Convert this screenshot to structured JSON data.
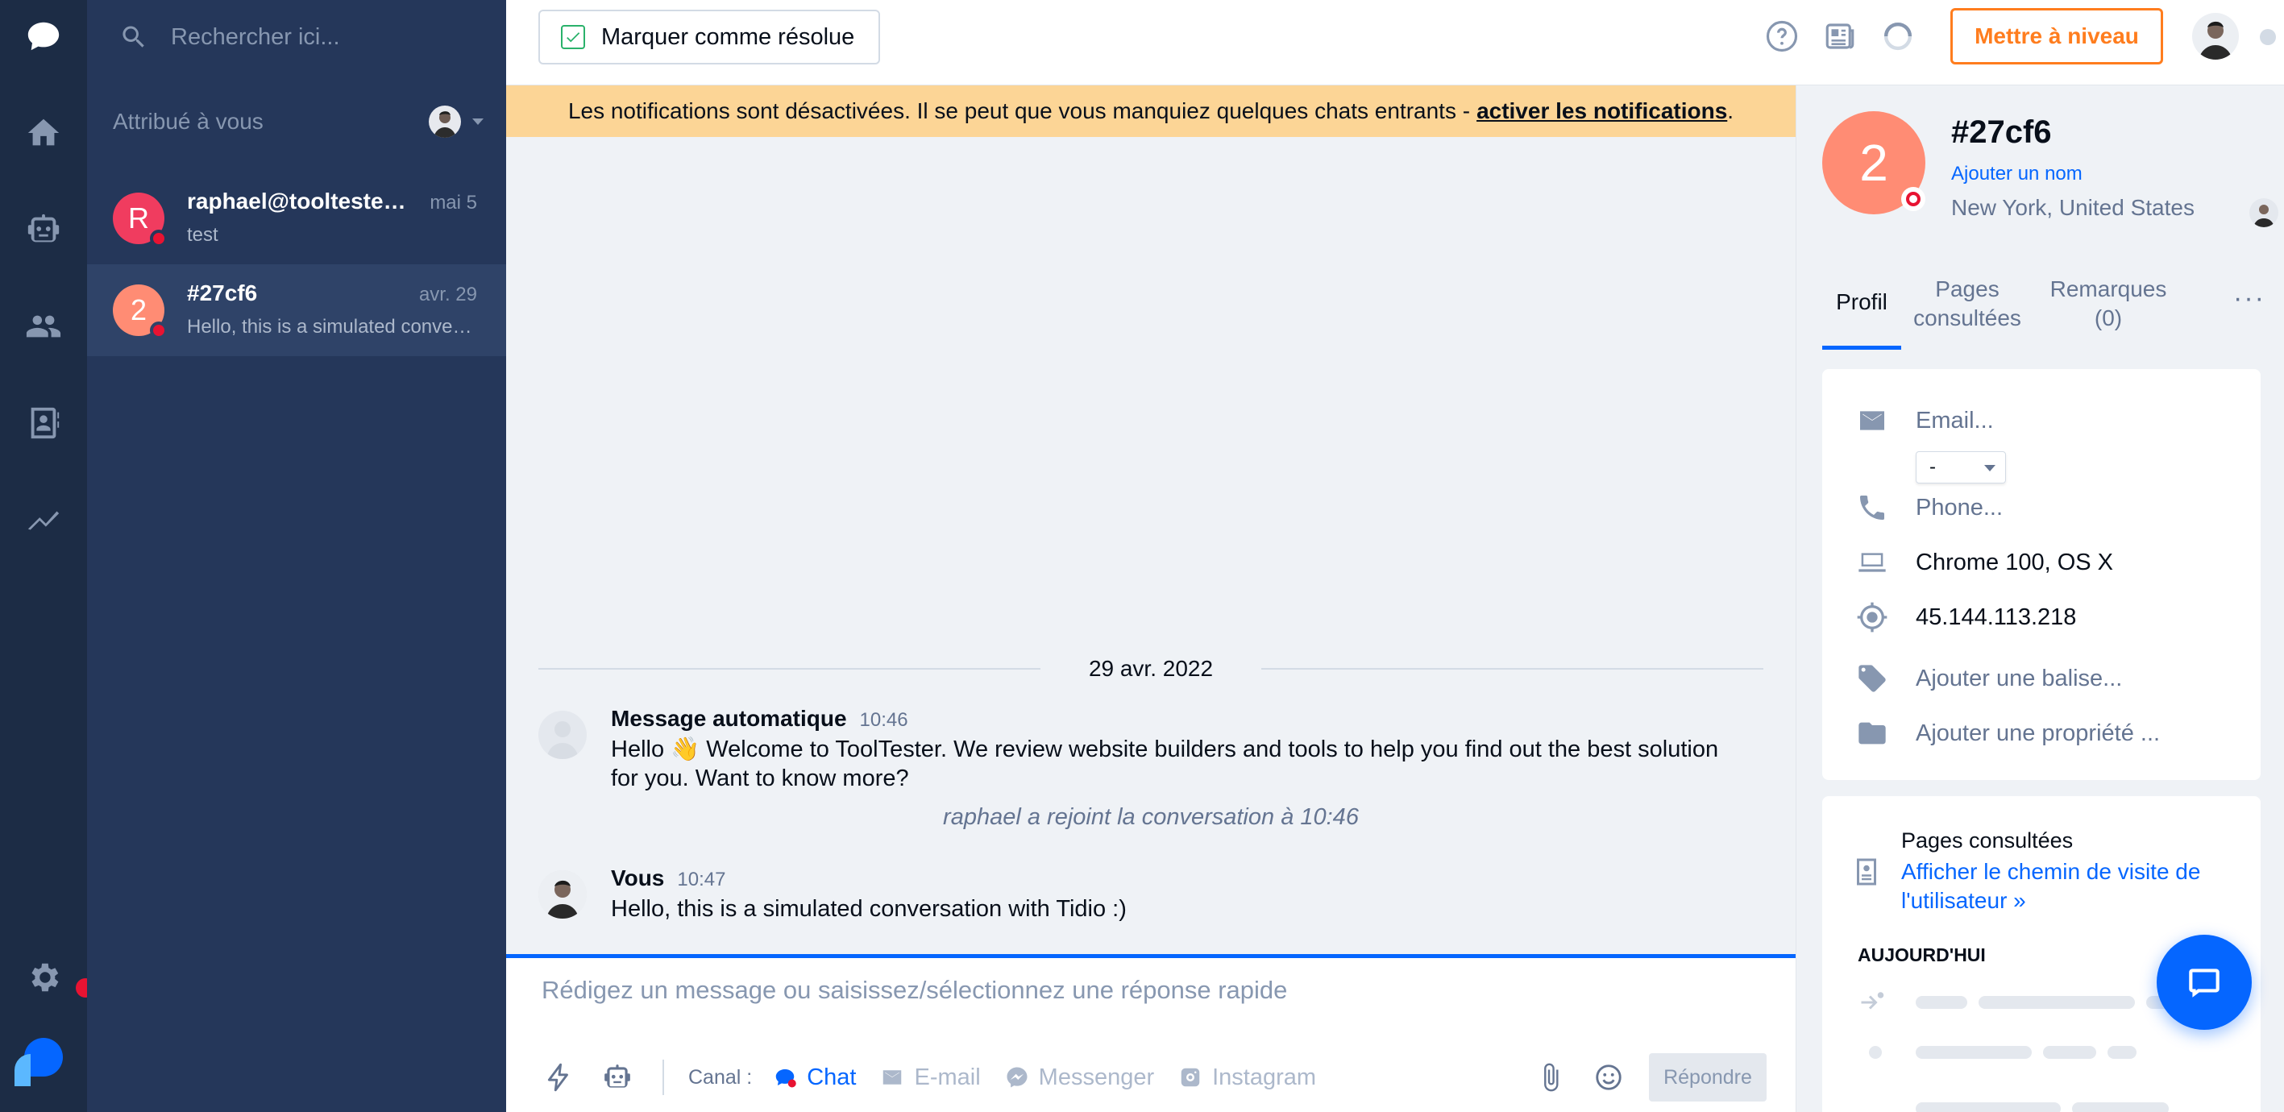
{
  "rail": {
    "items": [
      "conversations-icon",
      "home-icon",
      "bot-icon",
      "visitors-icon",
      "contacts-icon",
      "analytics-icon"
    ],
    "settings_icon": "gear-icon",
    "brand": "tidio-logo"
  },
  "list": {
    "search_placeholder": "Rechercher ici...",
    "assigned_label": "Attribué à vous",
    "conversations": [
      {
        "initial": "R",
        "name": "raphael@tooltester.com",
        "date": "mai 5",
        "preview": "test",
        "color": "#f03c5f"
      },
      {
        "initial": "2",
        "name": "#27cf6",
        "date": "avr. 29",
        "preview": "Hello, this is a simulated conversation with Tidio :)",
        "color": "#ff8c74"
      }
    ]
  },
  "topbar": {
    "resolve_label": "Marquer comme résolue",
    "upgrade_label": "Mettre à niveau",
    "icons": [
      "help-icon",
      "news-icon",
      "spinner-icon"
    ]
  },
  "banner": {
    "text": "Les notifications sont désactivées. Il se peut que vous manquiez quelques chats entrants -",
    "link": "activer les notifications",
    "suffix": "."
  },
  "chat": {
    "date": "29 avr. 2022",
    "messages": [
      {
        "author": "Message automatique",
        "time": "10:46",
        "text": "Hello 👋 Welcome to ToolTester. We review website builders and tools to help you find out the best solution for you. Want to know more?"
      },
      {
        "author": "Vous",
        "time": "10:47",
        "text": "Hello, this is a simulated conversation with Tidio :)"
      }
    ],
    "joined": "raphael a rejoint la conversation à 10:46"
  },
  "composer": {
    "placeholder": "Rédigez un message ou saisissez/sélectionnez une réponse rapide",
    "canal_label": "Canal :",
    "channels": [
      "Chat",
      "E-mail",
      "Messenger",
      "Instagram"
    ],
    "active_channel": "Chat",
    "reply_label": "Répondre"
  },
  "visitor": {
    "initial": "2",
    "id": "#27cf6",
    "add_name": "Ajouter un nom",
    "location": "New York, United States",
    "tabs": [
      "Profil",
      "Pages consultées",
      "Remarques (0)"
    ],
    "more": "···",
    "email_placeholder": "Email...",
    "email_select": "-",
    "phone_placeholder": "Phone...",
    "browser": "Chrome 100, OS X",
    "ip": "45.144.113.218",
    "add_tag": "Ajouter une balise...",
    "add_property": "Ajouter une propriété ...",
    "pages_title": "Pages consultées",
    "pages_link": "Afficher le chemin de visite de l'utilisateur »",
    "today": "AUJOURD'HUI"
  },
  "colors": {
    "accent": "#0566ff",
    "upgrade": "#ff7d1e",
    "rail": "#1c2c45",
    "list": "#25375a",
    "banner": "#fcd596",
    "status_red": "#e81332"
  }
}
